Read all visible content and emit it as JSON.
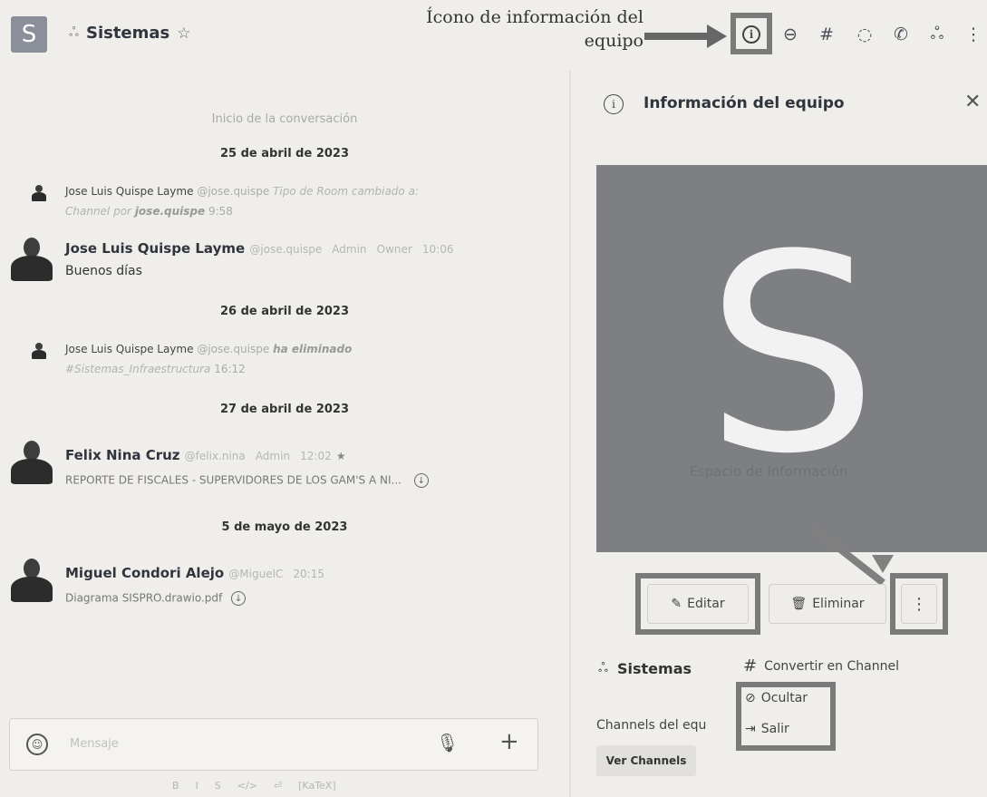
{
  "header": {
    "avatar_letter": "S",
    "room_name": "Sistemas",
    "callout": "Ícono de información del equipo",
    "icons": [
      "info-icon",
      "threads-icon",
      "channels-icon",
      "discussion-icon",
      "call-icon",
      "members-icon",
      "kebab-icon"
    ]
  },
  "chat": {
    "conversation_start": "Inicio de la conversación",
    "dates": [
      "25 de abril de 2023",
      "26 de abril de 2023",
      "27 de abril de 2023",
      "5 de mayo de 2023"
    ],
    "messages": [
      {
        "name": "Jose Luis Quispe Layme",
        "handle": "@jose.quispe",
        "text": "Tipo de Room cambiado a:",
        "text2_a": "Channel por",
        "text2_b": "jose.quispe",
        "time": "9:58"
      },
      {
        "name": "Jose Luis Quispe Layme",
        "handle": "@jose.quispe",
        "role1": "Admin",
        "role2": "Owner",
        "time": "10:06",
        "body": "Buenos días"
      },
      {
        "name": "Jose Luis Quispe Layme",
        "handle": "@jose.quispe",
        "text": "ha eliminado",
        "channel": "#Sistemas_Infraestructura",
        "time": "16:12"
      },
      {
        "name": "Felix Nina Cruz",
        "handle": "@felix.nina",
        "role1": "Admin",
        "time": "12:02",
        "body": "REPORTE DE FISCALES - SUPERVIDORES DE LOS GAM'S A NI..."
      },
      {
        "name": "Miguel Condori Alejo",
        "handle": "@MiguelC",
        "time": "20:15",
        "body": "Diagrama SISPRO.drawio.pdf"
      }
    ]
  },
  "composer": {
    "placeholder": "Mensaje",
    "format": [
      "B",
      "I",
      "S",
      "</>",
      "⏎",
      "[KaTeX]"
    ]
  },
  "panel": {
    "title": "Información del equipo",
    "avatar_letter": "S",
    "faded_text": "Espacio de Información",
    "edit_label": "Editar",
    "delete_label": "Eliminar",
    "team_name": "Sistemas",
    "convert_label": "Convertir en Channel",
    "menu": [
      "Ocultar",
      "Salir"
    ],
    "channels_label": "Channels del equ",
    "ver_channels": "Ver Channels"
  },
  "colors": {
    "background": "#efeeea",
    "highlight_border": "#7a7a7a",
    "avatar_grey": "#7d7f82"
  }
}
